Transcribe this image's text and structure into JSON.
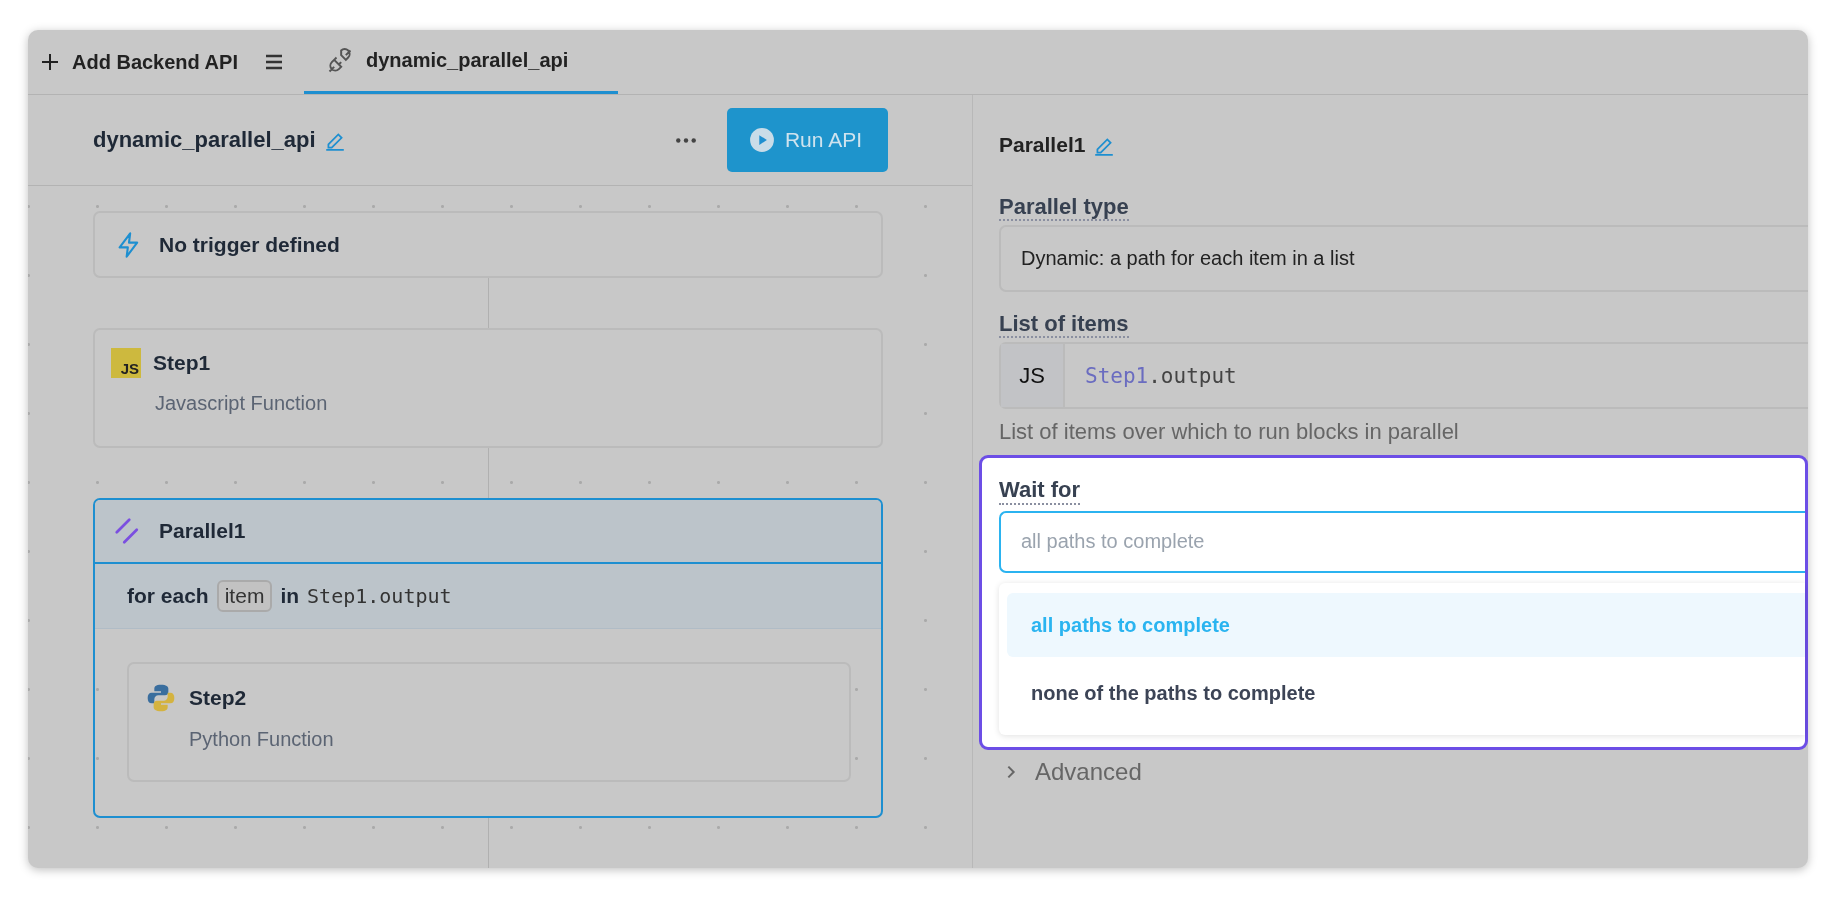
{
  "top_bar": {
    "add_button": "Add Backend API",
    "tabs": [
      {
        "label": "dynamic_parallel_api",
        "selected": true
      }
    ]
  },
  "api_header": {
    "title": "dynamic_parallel_api",
    "run_button": "Run API"
  },
  "flow": {
    "trigger": "No trigger defined",
    "steps": [
      {
        "kind": "js",
        "badge": "JS",
        "name": "Step1",
        "subtitle": "Javascript Function",
        "selected": false
      },
      {
        "kind": "parallel",
        "name": "Parallel1",
        "selected": true,
        "loop": {
          "prefix": "for each",
          "variable": "item",
          "keyword": "in",
          "expression": "Step1.output"
        },
        "children": [
          {
            "kind": "python",
            "name": "Step2",
            "subtitle": "Python Function",
            "selected": false
          }
        ]
      }
    ]
  },
  "inspector": {
    "title": "Parallel1",
    "parallel_type": {
      "label": "Parallel type",
      "value": "Dynamic: a path for each item in a list"
    },
    "list_of_items": {
      "label": "List of items",
      "mode": "JS",
      "code_object": "Step1",
      "code_rest": ".output",
      "help": "List of items over which to run blocks in parallel"
    },
    "wait_for": {
      "label": "Wait for",
      "placeholder": "all paths to complete",
      "options": [
        {
          "label": "all paths to complete",
          "selected": true
        },
        {
          "label": "none of the paths to complete",
          "selected": false
        }
      ]
    },
    "advanced": {
      "label": "Advanced",
      "expanded": false
    }
  }
}
